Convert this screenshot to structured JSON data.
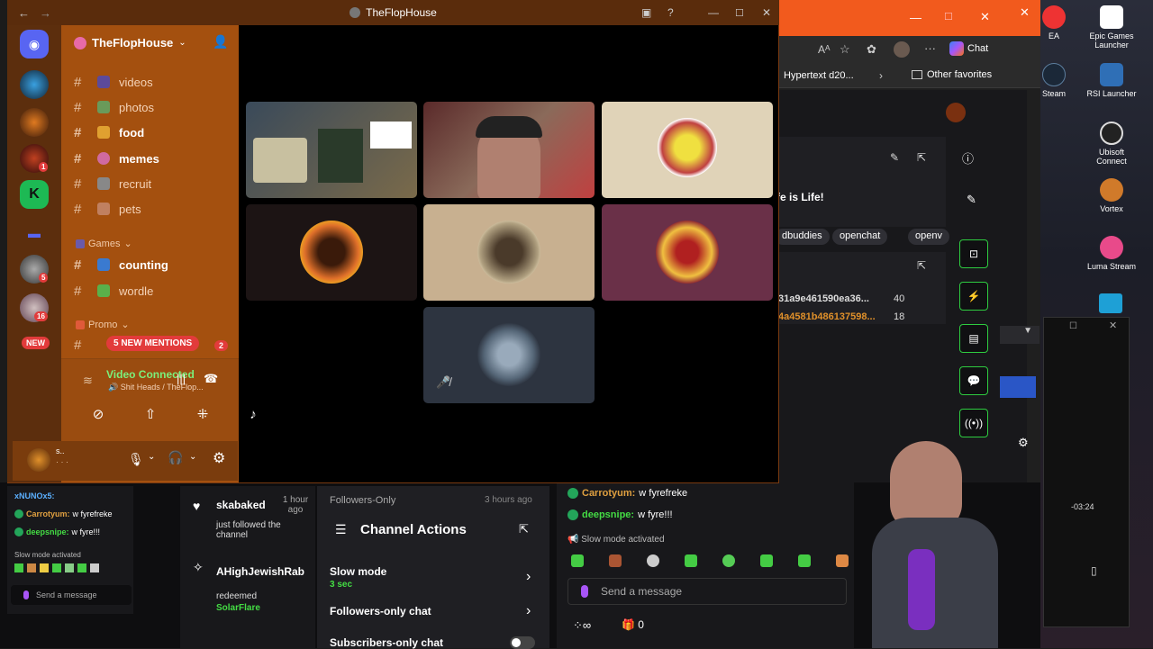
{
  "discord": {
    "window_title": "TheFlopHouse",
    "server_name": "TheFlopHouse",
    "channels": [
      {
        "name": "videos"
      },
      {
        "name": "photos"
      },
      {
        "name": "food"
      },
      {
        "name": "memes"
      },
      {
        "name": "recruit"
      },
      {
        "name": "pets"
      }
    ],
    "category_games": "Games",
    "games_channels": [
      {
        "name": "counting"
      },
      {
        "name": "wordle"
      }
    ],
    "category_promo": "Promo",
    "new_mentions": "5 NEW MENTIONS",
    "mentions_count": "2",
    "guild_badges": {
      "b1": "1",
      "b2": "5",
      "b3": "16",
      "new": "NEW"
    },
    "voice": {
      "status": "Video Connected",
      "channel": "Shit Heads / TheFlop..."
    },
    "user": {
      "name": "s..",
      "status": "· · ·"
    }
  },
  "edge": {
    "chat_button": "Chat",
    "favorite1": "Hypertext d20...",
    "other_favorites": "Other favorites",
    "stream_title": "fe is Life!",
    "tags": [
      "dbuddies",
      "openchat",
      "openv"
    ],
    "hashes": [
      {
        "hash": "31a9e461590ea36...",
        "count": "40"
      },
      {
        "hash": "4a4581b486137598...",
        "count": "18"
      }
    ],
    "timer": "-03:24"
  },
  "twitch": {
    "small_chat": {
      "user0": "xNUNOx5:",
      "line1_user": "Carrotyum:",
      "line1_msg": "w fyrefreke",
      "line2_user": "deepsnipe:",
      "line2_msg": "w fyre!!!",
      "slow_mode": "Slow mode activated",
      "placeholder": "Send a message"
    },
    "activity": [
      {
        "user": "skabaked",
        "time": "1 hour ago",
        "text": "just followed the channel"
      },
      {
        "user": "AHighJewishRab",
        "text": "redeemed",
        "reward": "SolarFlare"
      }
    ],
    "followers_only_header": "Followers-Only",
    "followers_time": "3 hours ago",
    "channel_actions": {
      "title": "Channel Actions",
      "slow_mode": "Slow mode",
      "slow_mode_value": "3 sec",
      "followers_only": "Followers-only chat",
      "subscribers_only": "Subscribers-only chat"
    },
    "chat": {
      "line1_user": "Carrotyum:",
      "line1_msg": "w fyrefreke",
      "line2_user": "deepsnipe:",
      "line2_msg": "w fyre!!!",
      "slow_mode": "Slow mode activated",
      "placeholder": "Send a message",
      "points_value": "0"
    }
  },
  "desktop_icons": [
    {
      "label": "EA"
    },
    {
      "label": "Epic Games Launcher"
    },
    {
      "label": "Steam"
    },
    {
      "label": "RSI Launcher"
    },
    {
      "label": "Ubisoft Connect"
    },
    {
      "label": "Vortex"
    },
    {
      "label": "Luma Stream"
    }
  ],
  "colors": {
    "discord_sidebar": "#a4500f",
    "discord_guildbar": "#5c2e0d",
    "twitch_green": "#2ecc40",
    "edge_orange": "#f25a1d"
  }
}
